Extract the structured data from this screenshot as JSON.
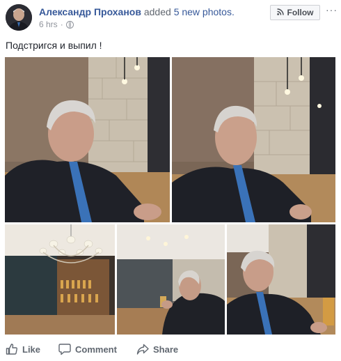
{
  "post": {
    "author": "Александр Проханов",
    "action": "added",
    "photos_link": "5 new photos.",
    "time": "6 hrs",
    "separator": "·",
    "privacy_icon": "globe-icon",
    "follow_label": "Follow",
    "more_label": "···",
    "status_text": "Подстригся и выпил !"
  },
  "photos": [
    {
      "label": "photo-1"
    },
    {
      "label": "photo-2"
    },
    {
      "label": "photo-3"
    },
    {
      "label": "photo-4"
    },
    {
      "label": "photo-5"
    }
  ],
  "footer": {
    "like_label": "Like",
    "comment_label": "Comment",
    "share_label": "Share"
  },
  "colors": {
    "link": "#365899",
    "meta": "#90949c",
    "footer_text": "#606770"
  }
}
